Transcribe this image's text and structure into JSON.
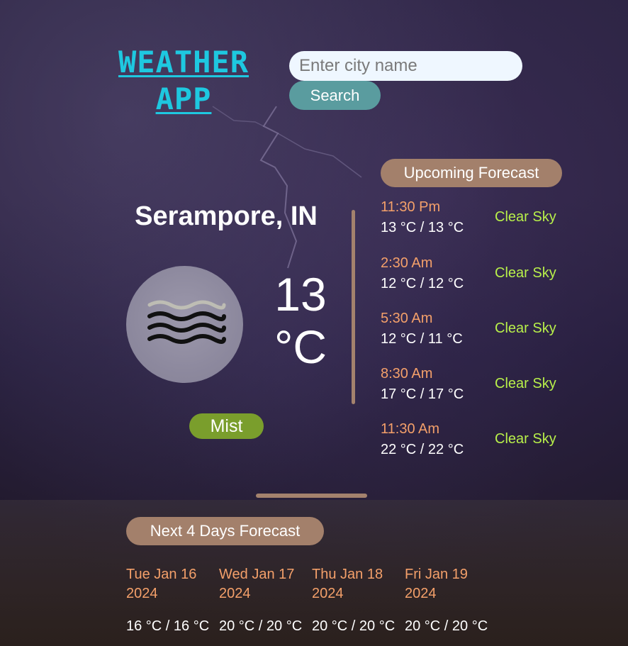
{
  "header": {
    "logo_line1": "WEATHER",
    "logo_line2": "APP",
    "search_placeholder": "Enter city name",
    "search_value": "",
    "search_button": "Search"
  },
  "current": {
    "city": "Serampore, IN",
    "temp_value": "13",
    "temp_unit": "°C",
    "condition": "Mist",
    "icon": "mist-icon"
  },
  "upcoming": {
    "title": "Upcoming Forecast",
    "items": [
      {
        "time": "11:30 Pm",
        "temp": "13 °C / 13 °C",
        "desc": "Clear Sky"
      },
      {
        "time": "2:30 Am",
        "temp": "12 °C / 12 °C",
        "desc": "Clear Sky"
      },
      {
        "time": "5:30 Am",
        "temp": "12 °C / 11 °C",
        "desc": "Clear Sky"
      },
      {
        "time": "8:30 Am",
        "temp": "17 °C / 17 °C",
        "desc": "Clear Sky"
      },
      {
        "time": "11:30 Am",
        "temp": "22 °C / 22 °C",
        "desc": "Clear Sky"
      }
    ]
  },
  "days": {
    "title": "Next 4 Days Forecast",
    "items": [
      {
        "date": "Tue Jan 16",
        "year": "2024",
        "temp": "16 °C / 16 °C"
      },
      {
        "date": "Wed Jan 17",
        "year": "2024",
        "temp": "20 °C / 20 °C"
      },
      {
        "date": "Thu Jan 18",
        "year": "2024",
        "temp": "20 °C / 20 °C"
      },
      {
        "date": "Fri Jan 19",
        "year": "2024",
        "temp": "20 °C / 20 °C"
      }
    ]
  },
  "colors": {
    "logo": "#1ec8e0",
    "search_button": "#5a9c9f",
    "badge_brown": "#a3806b",
    "mist_badge": "#7a9e2c",
    "time_orange": "#f4a06a",
    "desc_green": "#b8f04a"
  }
}
